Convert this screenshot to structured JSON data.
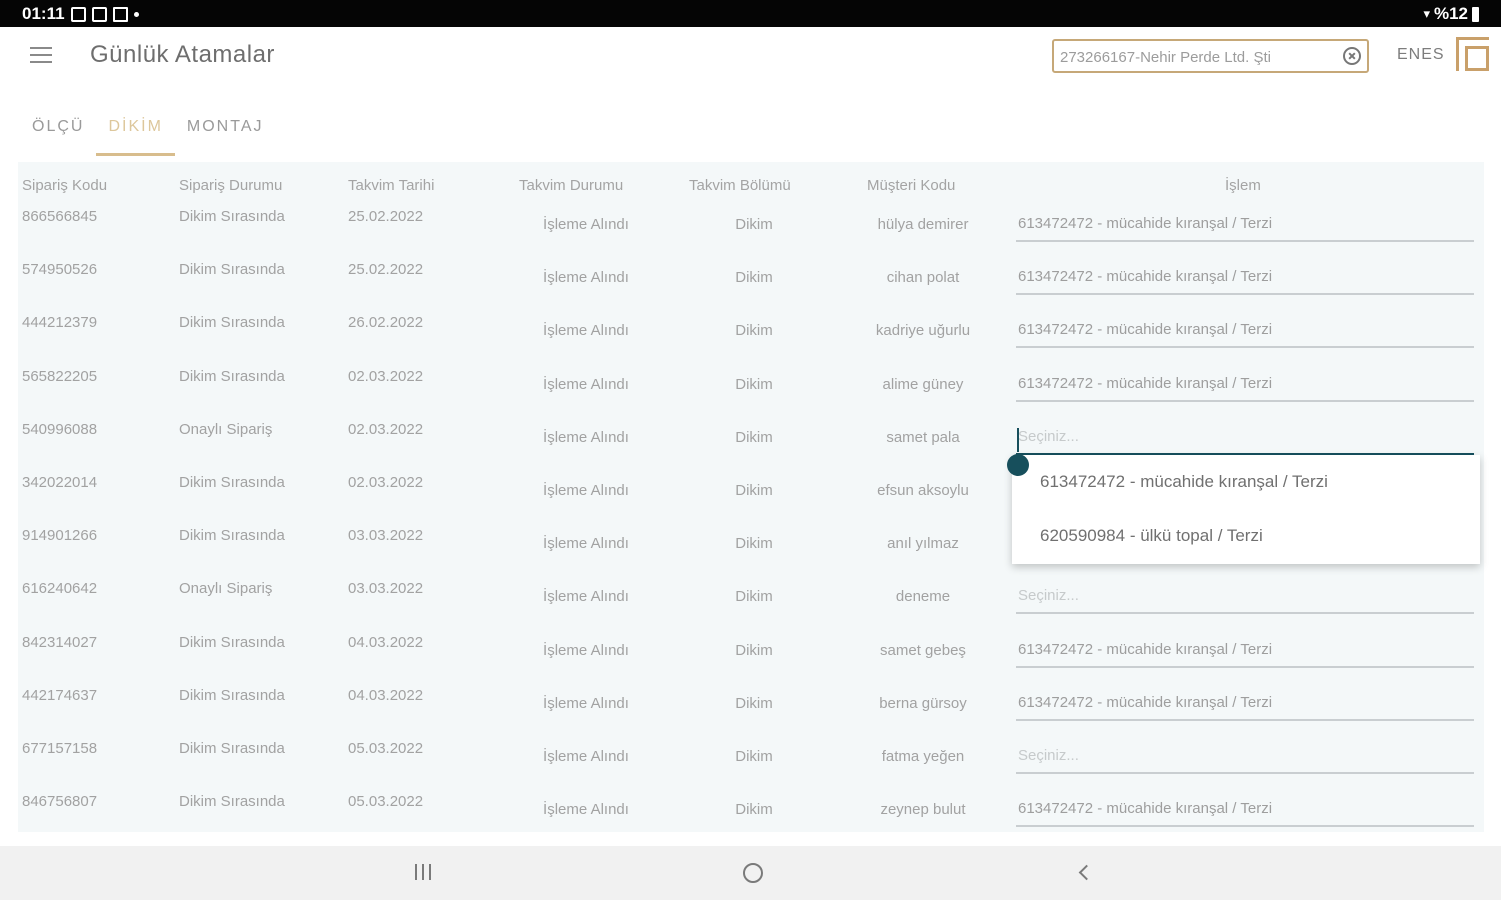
{
  "status_bar": {
    "time": "01:11",
    "battery_text": "%12"
  },
  "header": {
    "title": "Günlük Atamalar",
    "company_value": "273266167-Nehir Perde Ltd. Şti",
    "user": "ENES"
  },
  "tabs": [
    {
      "label": "ÖLÇÜ",
      "active": false
    },
    {
      "label": "DİKİM",
      "active": true
    },
    {
      "label": "MONTAJ",
      "active": false
    }
  ],
  "table": {
    "columns": [
      "Sipariş Kodu",
      "Sipariş Durumu",
      "Takvim Tarihi",
      "Takvim Durumu",
      "Takvim Bölümü",
      "Müşteri Kodu",
      "İşlem"
    ],
    "placeholder": "Seçiniz...",
    "rows": [
      {
        "code": "866566845",
        "status": "Dikim Sırasında",
        "date": "25.02.2022",
        "cal_status": "İşleme Alındı",
        "section": "Dikim",
        "customer": "hülya demirer",
        "assignment": "613472472 - mücahide kıranşal / Terzi"
      },
      {
        "code": "574950526",
        "status": "Dikim Sırasında",
        "date": "25.02.2022",
        "cal_status": "İşleme Alındı",
        "section": "Dikim",
        "customer": "cihan polat",
        "assignment": "613472472 - mücahide kıranşal / Terzi"
      },
      {
        "code": "444212379",
        "status": "Dikim Sırasında",
        "date": "26.02.2022",
        "cal_status": "İşleme Alındı",
        "section": "Dikim",
        "customer": "kadriye uğurlu",
        "assignment": "613472472 - mücahide kıranşal / Terzi"
      },
      {
        "code": "565822205",
        "status": "Dikim Sırasında",
        "date": "02.03.2022",
        "cal_status": "İşleme Alındı",
        "section": "Dikim",
        "customer": "alime güney",
        "assignment": "613472472 - mücahide kıranşal / Terzi"
      },
      {
        "code": "540996088",
        "status": "Onaylı Sipariş",
        "date": "02.03.2022",
        "cal_status": "İşleme Alındı",
        "section": "Dikim",
        "customer": "samet pala",
        "assignment": ""
      },
      {
        "code": "342022014",
        "status": "Dikim Sırasında",
        "date": "02.03.2022",
        "cal_status": "İşleme Alındı",
        "section": "Dikim",
        "customer": "efsun aksoylu",
        "assignment": null
      },
      {
        "code": "914901266",
        "status": "Dikim Sırasında",
        "date": "03.03.2022",
        "cal_status": "İşleme Alındı",
        "section": "Dikim",
        "customer": "anıl yılmaz",
        "assignment": null
      },
      {
        "code": "616240642",
        "status": "Onaylı Sipariş",
        "date": "03.03.2022",
        "cal_status": "İşleme Alındı",
        "section": "Dikim",
        "customer": "deneme",
        "assignment": ""
      },
      {
        "code": "842314027",
        "status": "Dikim Sırasında",
        "date": "04.03.2022",
        "cal_status": "İşleme Alındı",
        "section": "Dikim",
        "customer": "samet gebeş",
        "assignment": "613472472 - mücahide kıranşal / Terzi"
      },
      {
        "code": "442174637",
        "status": "Dikim Sırasında",
        "date": "04.03.2022",
        "cal_status": "İşleme Alındı",
        "section": "Dikim",
        "customer": "berna gürsoy",
        "assignment": "613472472 - mücahide kıranşal / Terzi"
      },
      {
        "code": "677157158",
        "status": "Dikim Sırasında",
        "date": "05.03.2022",
        "cal_status": "İşleme Alındı",
        "section": "Dikim",
        "customer": "fatma yeğen",
        "assignment": ""
      },
      {
        "code": "846756807",
        "status": "Dikim Sırasında",
        "date": "05.03.2022",
        "cal_status": "İşleme Alındı",
        "section": "Dikim",
        "customer": "zeynep bulut",
        "assignment": "613472472 - mücahide kıranşal / Terzi"
      }
    ]
  },
  "dropdown": {
    "options": [
      "613472472 - mücahide kıranşal / Terzi",
      "620590984 - ülkü topal / Terzi"
    ]
  },
  "colors": {
    "accent": "#d8bd8d",
    "focus": "#16505e",
    "table_bg": "#f4f8f9"
  }
}
